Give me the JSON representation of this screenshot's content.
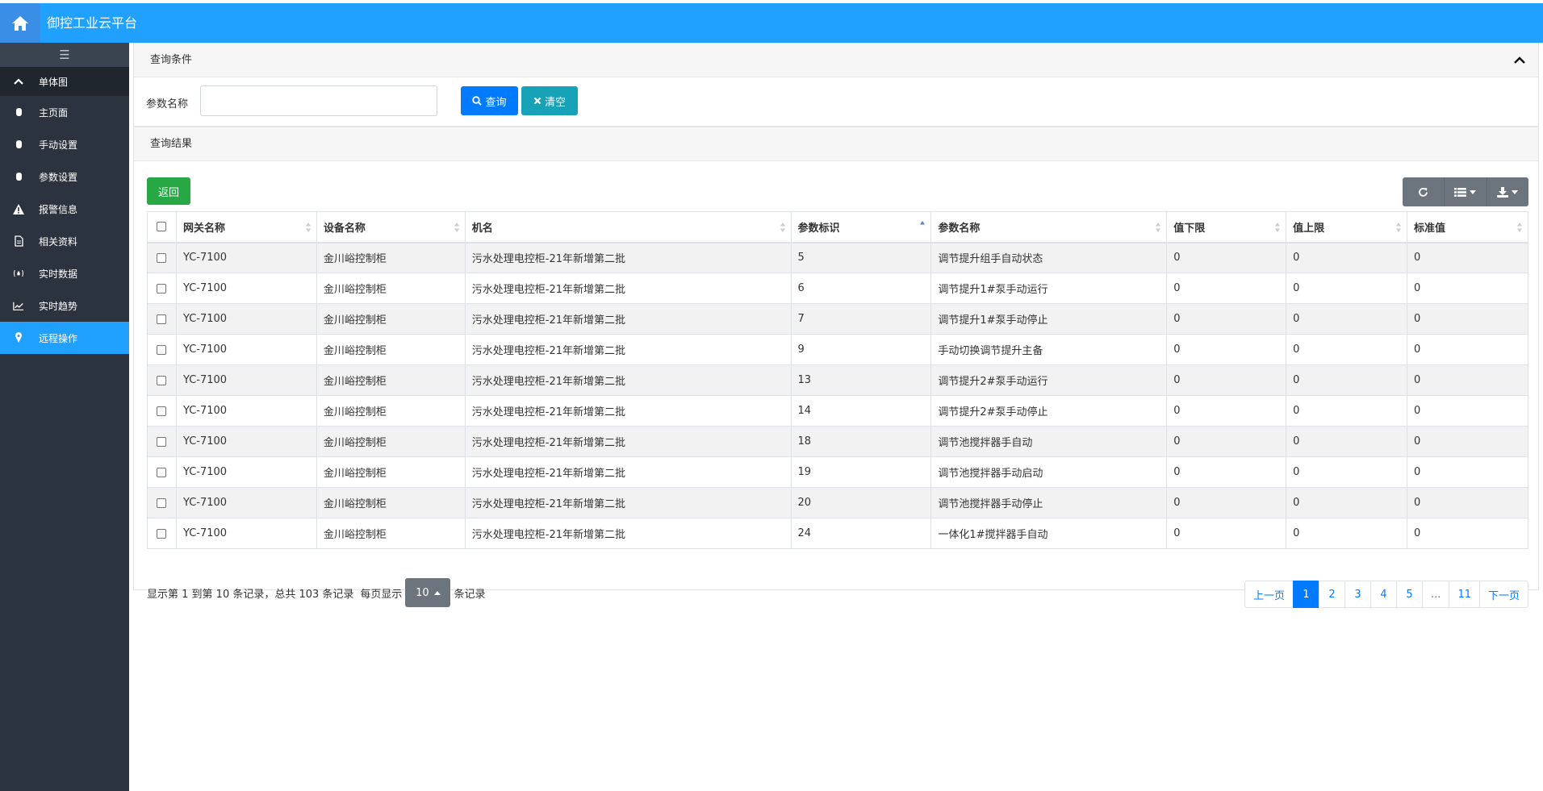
{
  "app": {
    "title": "御控工业云平台",
    "colors": {
      "header": "#20a0ff",
      "sidebar": "#2b333e",
      "active": "#20a0ff"
    }
  },
  "sidebar": {
    "toggle": "☰",
    "group": "单体图",
    "items": [
      {
        "label": "主页面",
        "icon": "database-icon"
      },
      {
        "label": "手动设置",
        "icon": "database-icon"
      },
      {
        "label": "参数设置",
        "icon": "database-icon"
      },
      {
        "label": "报警信息",
        "icon": "warning-icon"
      },
      {
        "label": "相关资料",
        "icon": "file-icon"
      },
      {
        "label": "实时数据",
        "icon": "fire-icon"
      },
      {
        "label": "实时趋势",
        "icon": "line-chart-icon"
      },
      {
        "label": "远程操作",
        "icon": "map-pin-icon"
      }
    ]
  },
  "query": {
    "panel_title": "查询条件",
    "param_label": "参数名称",
    "param_value": "",
    "query_button": "查询",
    "clear_button": "清空"
  },
  "results": {
    "panel_title": "查询结果",
    "back_button": "返回",
    "columns": [
      "网关名称",
      "设备名称",
      "机名",
      "参数标识",
      "参数名称",
      "值下限",
      "值上限",
      "标准值"
    ],
    "rows": [
      [
        "YC-7100",
        "金川峪控制柜",
        "污水处理电控柜-21年新增第二批",
        "5",
        "调节提升组手自动状态",
        "0",
        "0",
        "0"
      ],
      [
        "YC-7100",
        "金川峪控制柜",
        "污水处理电控柜-21年新增第二批",
        "6",
        "调节提升1#泵手动运行",
        "0",
        "0",
        "0"
      ],
      [
        "YC-7100",
        "金川峪控制柜",
        "污水处理电控柜-21年新增第二批",
        "7",
        "调节提升1#泵手动停止",
        "0",
        "0",
        "0"
      ],
      [
        "YC-7100",
        "金川峪控制柜",
        "污水处理电控柜-21年新增第二批",
        "9",
        "手动切换调节提升主备",
        "0",
        "0",
        "0"
      ],
      [
        "YC-7100",
        "金川峪控制柜",
        "污水处理电控柜-21年新增第二批",
        "13",
        "调节提升2#泵手动运行",
        "0",
        "0",
        "0"
      ],
      [
        "YC-7100",
        "金川峪控制柜",
        "污水处理电控柜-21年新增第二批",
        "14",
        "调节提升2#泵手动停止",
        "0",
        "0",
        "0"
      ],
      [
        "YC-7100",
        "金川峪控制柜",
        "污水处理电控柜-21年新增第二批",
        "18",
        "调节池搅拌器手自动",
        "0",
        "0",
        "0"
      ],
      [
        "YC-7100",
        "金川峪控制柜",
        "污水处理电控柜-21年新增第二批",
        "19",
        "调节池搅拌器手动启动",
        "0",
        "0",
        "0"
      ],
      [
        "YC-7100",
        "金川峪控制柜",
        "污水处理电控柜-21年新增第二批",
        "20",
        "调节池搅拌器手动停止",
        "0",
        "0",
        "0"
      ],
      [
        "YC-7100",
        "金川峪控制柜",
        "污水处理电控柜-21年新增第二批",
        "24",
        "一体化1#搅拌器手自动",
        "0",
        "0",
        "0"
      ]
    ],
    "pager_text_before": "显示第 1 到第 10 条记录，总共 103 条记录",
    "per_page_label": "每页显示",
    "per_page_value": "10",
    "per_page_suffix": "条记录",
    "pages": [
      "上一页",
      "1",
      "2",
      "3",
      "4",
      "5",
      "...",
      "11",
      "下一页"
    ],
    "active_page": "1"
  }
}
